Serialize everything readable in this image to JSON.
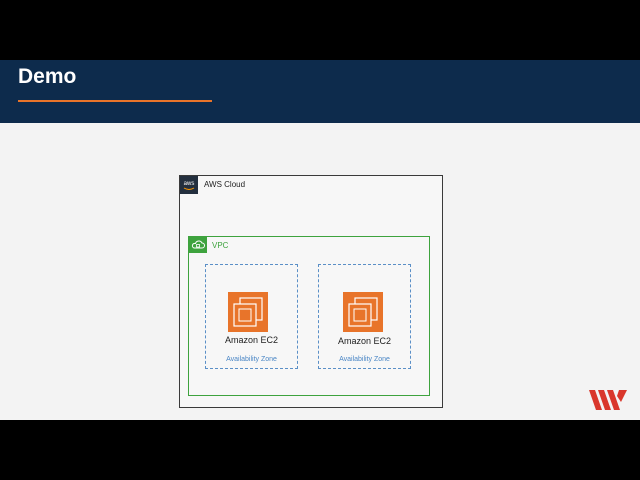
{
  "slide": {
    "title": "Demo"
  },
  "diagram": {
    "cloud_label": "AWS Cloud",
    "aws_logo_text": "aws",
    "vpc_label": "VPC",
    "zones": [
      {
        "instance_label": "Amazon EC2",
        "zone_label": "Availability Zone"
      },
      {
        "instance_label": "Amazon EC2",
        "zone_label": "Availability Zone"
      }
    ]
  },
  "colors": {
    "header_bg": "#0d2b4c",
    "accent": "#e8742a",
    "vpc_green": "#3ea33e",
    "az_blue": "#5a8fc7",
    "ec2_orange": "#e8742a",
    "brand_red": "#d9362b"
  },
  "icons": [
    "aws-logo-icon",
    "vpc-cloud-icon",
    "ec2-chip-icon",
    "brand-logo-icon"
  ]
}
